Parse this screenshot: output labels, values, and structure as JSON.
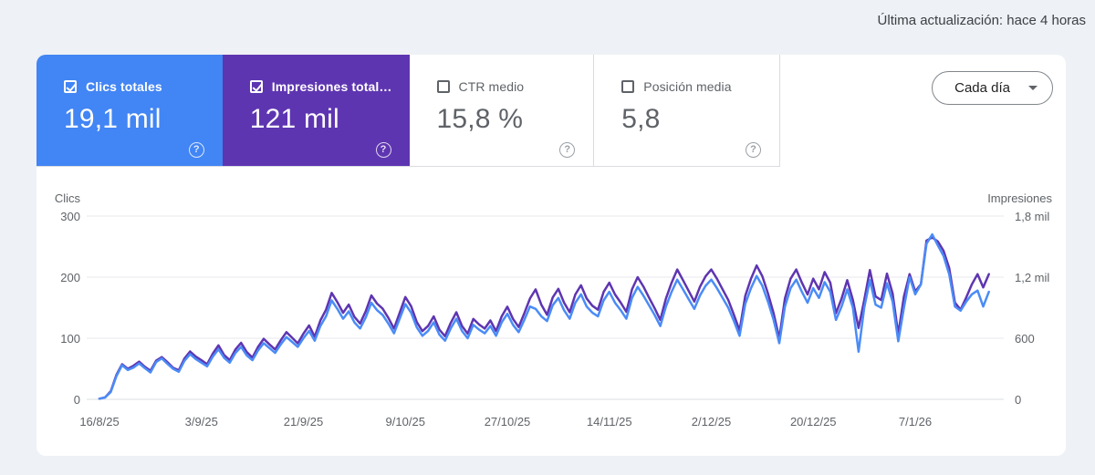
{
  "header": {
    "last_updated": "Última actualización: hace 4 horas"
  },
  "toolbar": {
    "granularity_label": "Cada día"
  },
  "icons": {
    "help_glyph": "?",
    "chevron": "▾"
  },
  "metrics": [
    {
      "label": "Clics totales",
      "value": "19,1 mil",
      "checked": true,
      "color": "#4285f4"
    },
    {
      "label": "Impresiones total…",
      "value": "121 mil",
      "checked": true,
      "color": "#5e35b1"
    },
    {
      "label": "CTR medio",
      "value": "15,8 %",
      "checked": false,
      "color": "#ffffff"
    },
    {
      "label": "Posición media",
      "value": "5,8",
      "checked": false,
      "color": "#ffffff"
    }
  ],
  "chart_data": {
    "type": "line",
    "x_tick_labels": [
      "16/8/25",
      "3/9/25",
      "21/9/25",
      "9/10/25",
      "27/10/25",
      "14/11/25",
      "2/12/25",
      "20/12/25",
      "7/1/26"
    ],
    "x_tick_indices": [
      0,
      18,
      36,
      54,
      72,
      90,
      108,
      126,
      144
    ],
    "num_points": 158,
    "grid_color": "#e8eaed",
    "zero_line_color": "#dadce0",
    "text_color": "#5f6368",
    "left_axis": {
      "label": "Clics",
      "max": 300,
      "ticks": [
        {
          "v": 0,
          "t": "0"
        },
        {
          "v": 100,
          "t": "100"
        },
        {
          "v": 200,
          "t": "200"
        },
        {
          "v": 300,
          "t": "300"
        }
      ]
    },
    "right_axis": {
      "label": "Impresiones",
      "max": 1800,
      "ticks": [
        {
          "v": 0,
          "t": "0"
        },
        {
          "v": 600,
          "t": "600"
        },
        {
          "v": 1200,
          "t": "1,2 mil"
        },
        {
          "v": 1800,
          "t": "1,8 mil"
        }
      ]
    },
    "series": [
      {
        "name": "Impresiones",
        "color": "#5e35b1",
        "axis": "right",
        "values": [
          6,
          20,
          80,
          240,
          345,
          300,
          330,
          370,
          320,
          280,
          380,
          415,
          365,
          310,
          285,
          400,
          470,
          420,
          385,
          345,
          450,
          530,
          435,
          385,
          490,
          555,
          465,
          410,
          515,
          595,
          540,
          490,
          580,
          660,
          605,
          550,
          645,
          725,
          615,
          775,
          880,
          1045,
          955,
          850,
          930,
          810,
          745,
          865,
          1020,
          940,
          890,
          800,
          695,
          850,
          1005,
          915,
          760,
          670,
          720,
          815,
          685,
          620,
          750,
          855,
          720,
          645,
          790,
          735,
          695,
          775,
          670,
          815,
          910,
          790,
          710,
          845,
          990,
          1080,
          930,
          830,
          1000,
          1085,
          950,
          855,
          1030,
          1120,
          990,
          920,
          880,
          1055,
          1145,
          1030,
          950,
          860,
          1080,
          1200,
          1110,
          1000,
          895,
          780,
          990,
          1145,
          1275,
          1170,
          1065,
          960,
          1105,
          1210,
          1275,
          1185,
          1080,
          975,
          830,
          675,
          1015,
          1185,
          1315,
          1210,
          1040,
          845,
          600,
          990,
          1185,
          1275,
          1145,
          1030,
          1185,
          1080,
          1250,
          1145,
          845,
          990,
          1170,
          975,
          700,
          975,
          1270,
          1010,
          975,
          1235,
          1040,
          640,
          1010,
          1230,
          1060,
          1130,
          1560,
          1590,
          1550,
          1460,
          1290,
          950,
          880,
          1000,
          1130,
          1230,
          1100,
          1230
        ]
      },
      {
        "name": "Clics",
        "color": "#4a8cf7",
        "axis": "left",
        "values": [
          1,
          3,
          12,
          38,
          56,
          48,
          52,
          59,
          51,
          44,
          61,
          67,
          58,
          50,
          45,
          63,
          74,
          66,
          60,
          54,
          70,
          82,
          68,
          60,
          76,
          86,
          72,
          64,
          80,
          92,
          84,
          76,
          90,
          102,
          94,
          86,
          100,
          112,
          96,
          120,
          136,
          162,
          148,
          132,
          144,
          126,
          116,
          134,
          158,
          146,
          138,
          124,
          108,
          132,
          156,
          142,
          118,
          104,
          112,
          126,
          106,
          96,
          116,
          132,
          112,
          100,
          122,
          114,
          108,
          120,
          104,
          126,
          140,
          122,
          110,
          130,
          152,
          148,
          136,
          128,
          154,
          166,
          146,
          132,
          158,
          172,
          152,
          142,
          136,
          162,
          176,
          158,
          146,
          132,
          166,
          184,
          170,
          154,
          138,
          120,
          152,
          176,
          196,
          180,
          164,
          148,
          170,
          186,
          196,
          182,
          166,
          150,
          128,
          104,
          156,
          182,
          202,
          186,
          160,
          130,
          92,
          152,
          182,
          196,
          176,
          158,
          182,
          166,
          192,
          176,
          130,
          152,
          180,
          150,
          78,
          150,
          195,
          155,
          150,
          190,
          160,
          95,
          150,
          200,
          172,
          188,
          255,
          270,
          252,
          235,
          205,
          152,
          145,
          160,
          172,
          178,
          152,
          176
        ]
      }
    ]
  }
}
